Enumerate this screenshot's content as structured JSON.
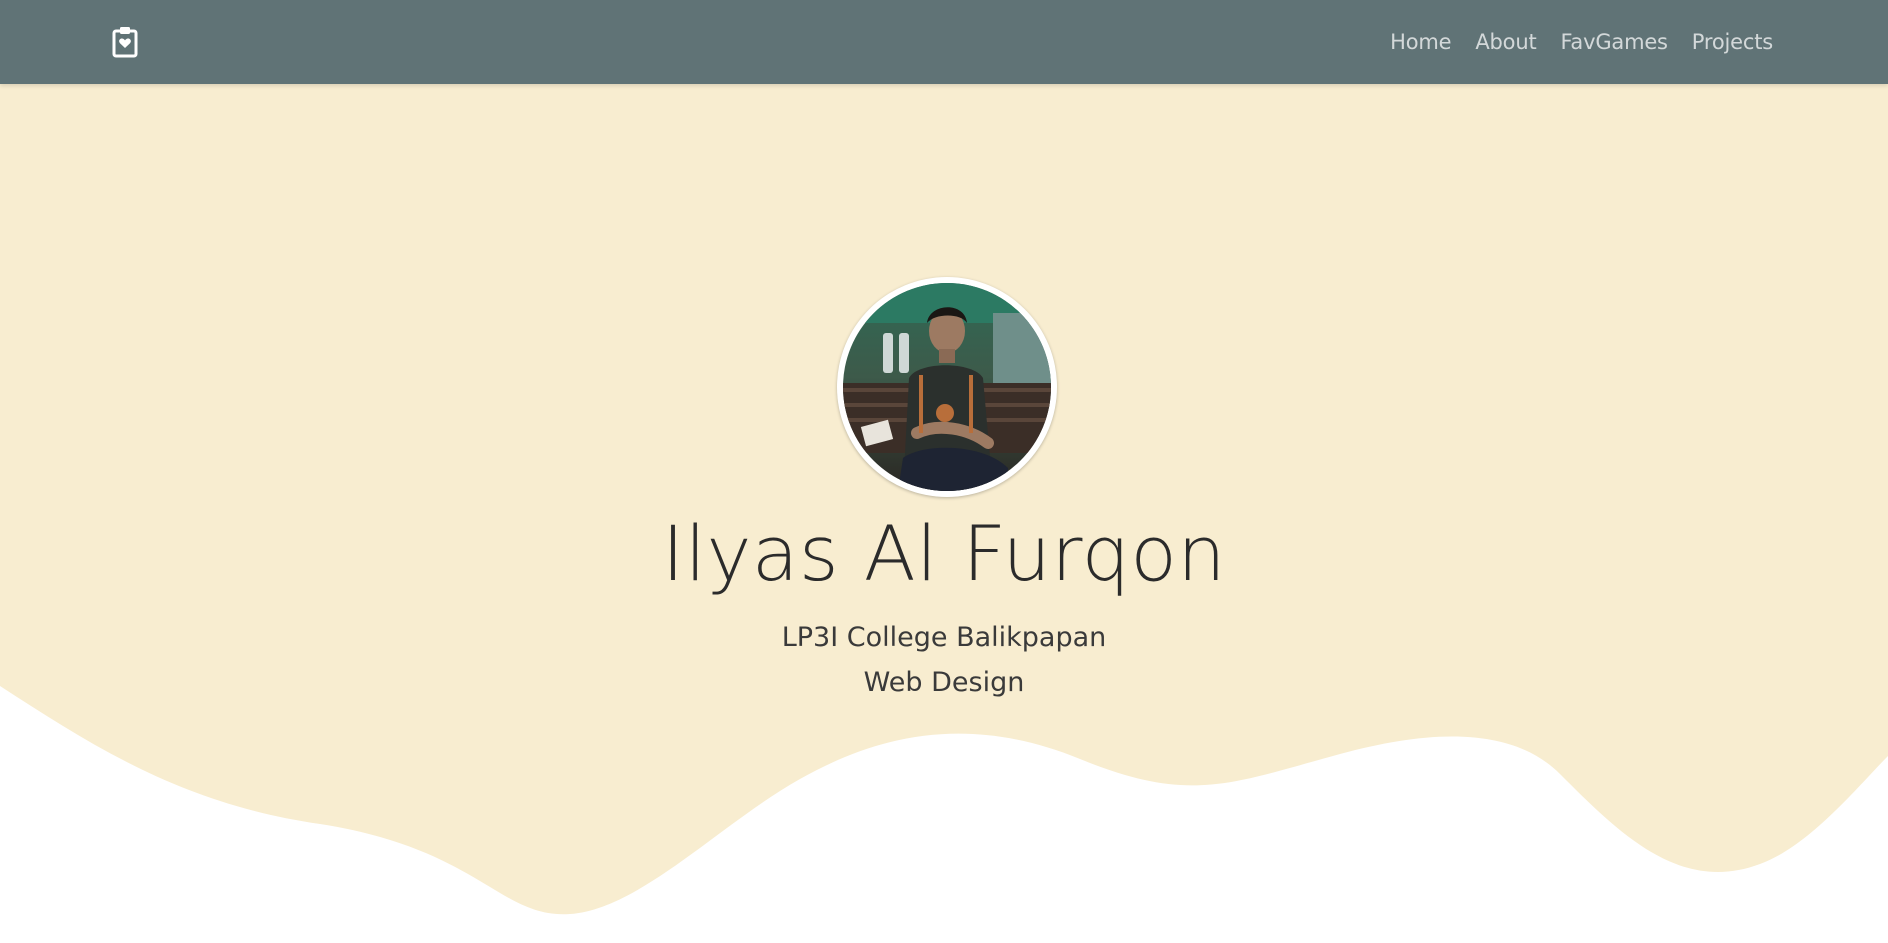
{
  "navbar": {
    "brand_icon": "clipboard-heart-icon",
    "background": "#607376",
    "links": [
      {
        "label": "Home"
      },
      {
        "label": "About"
      },
      {
        "label": "FavGames"
      },
      {
        "label": "Projects"
      }
    ]
  },
  "hero": {
    "background": "#f8edd0",
    "profile_image": "profile-photo",
    "name": "Ilyas Al Furqon",
    "subtitle_line1": "LP3I College Balikpapan",
    "subtitle_line2": "Web Design"
  }
}
